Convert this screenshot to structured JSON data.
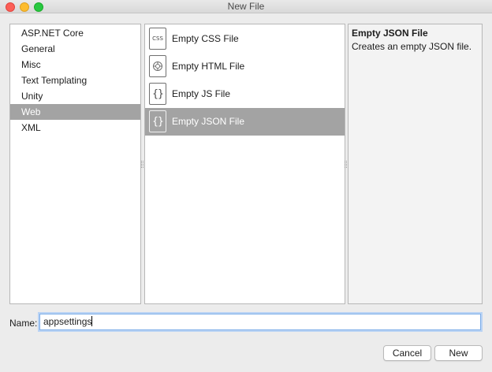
{
  "window": {
    "title": "New File"
  },
  "categories": [
    {
      "label": "ASP.NET Core",
      "selected": false
    },
    {
      "label": "General",
      "selected": false
    },
    {
      "label": "Misc",
      "selected": false
    },
    {
      "label": "Text Templating",
      "selected": false
    },
    {
      "label": "Unity",
      "selected": false
    },
    {
      "label": "Web",
      "selected": true
    },
    {
      "label": "XML",
      "selected": false
    }
  ],
  "templates": [
    {
      "label": "Empty CSS File",
      "icon": "css-file-icon",
      "icon_text": "CSS",
      "selected": false
    },
    {
      "label": "Empty HTML File",
      "icon": "html-file-icon",
      "icon_text": "",
      "selected": false
    },
    {
      "label": "Empty JS File",
      "icon": "js-file-icon",
      "icon_text": "{}",
      "selected": false
    },
    {
      "label": "Empty JSON File",
      "icon": "json-file-icon",
      "icon_text": "{}",
      "selected": true
    }
  ],
  "details": {
    "title": "Empty JSON File",
    "description": "Creates an empty JSON file."
  },
  "name_field": {
    "label": "Name:",
    "value": "appsettings"
  },
  "buttons": {
    "cancel": "Cancel",
    "new": "New"
  },
  "colors": {
    "selection": "#a3a3a3",
    "focus_ring": "#7eaee9"
  }
}
